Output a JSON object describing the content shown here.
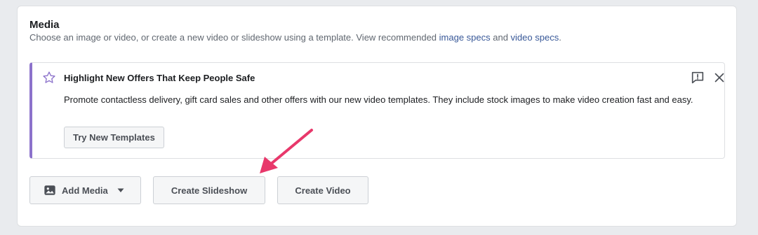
{
  "media": {
    "title": "Media",
    "description_prefix": "Choose an image or video, or create a new video or slideshow using a template. View recommended ",
    "image_specs_link": "image specs",
    "description_and": " and ",
    "video_specs_link": "video specs",
    "description_suffix": "."
  },
  "promo": {
    "title": "Highlight New Offers That Keep People Safe",
    "body": "Promote contactless delivery, gift card sales and other offers with our new video templates. They include stock images to make video creation fast and easy.",
    "button_label": "Try New Templates",
    "accent_color": "#8c72cb",
    "icons": [
      "star-icon",
      "feedback-icon",
      "close-icon"
    ]
  },
  "actions": {
    "add_media_label": "Add Media",
    "create_slideshow_label": "Create Slideshow",
    "create_video_label": "Create Video",
    "icons": [
      "image-icon",
      "caret-down-icon"
    ]
  },
  "annotation": {
    "arrow_color": "#e8386b"
  }
}
